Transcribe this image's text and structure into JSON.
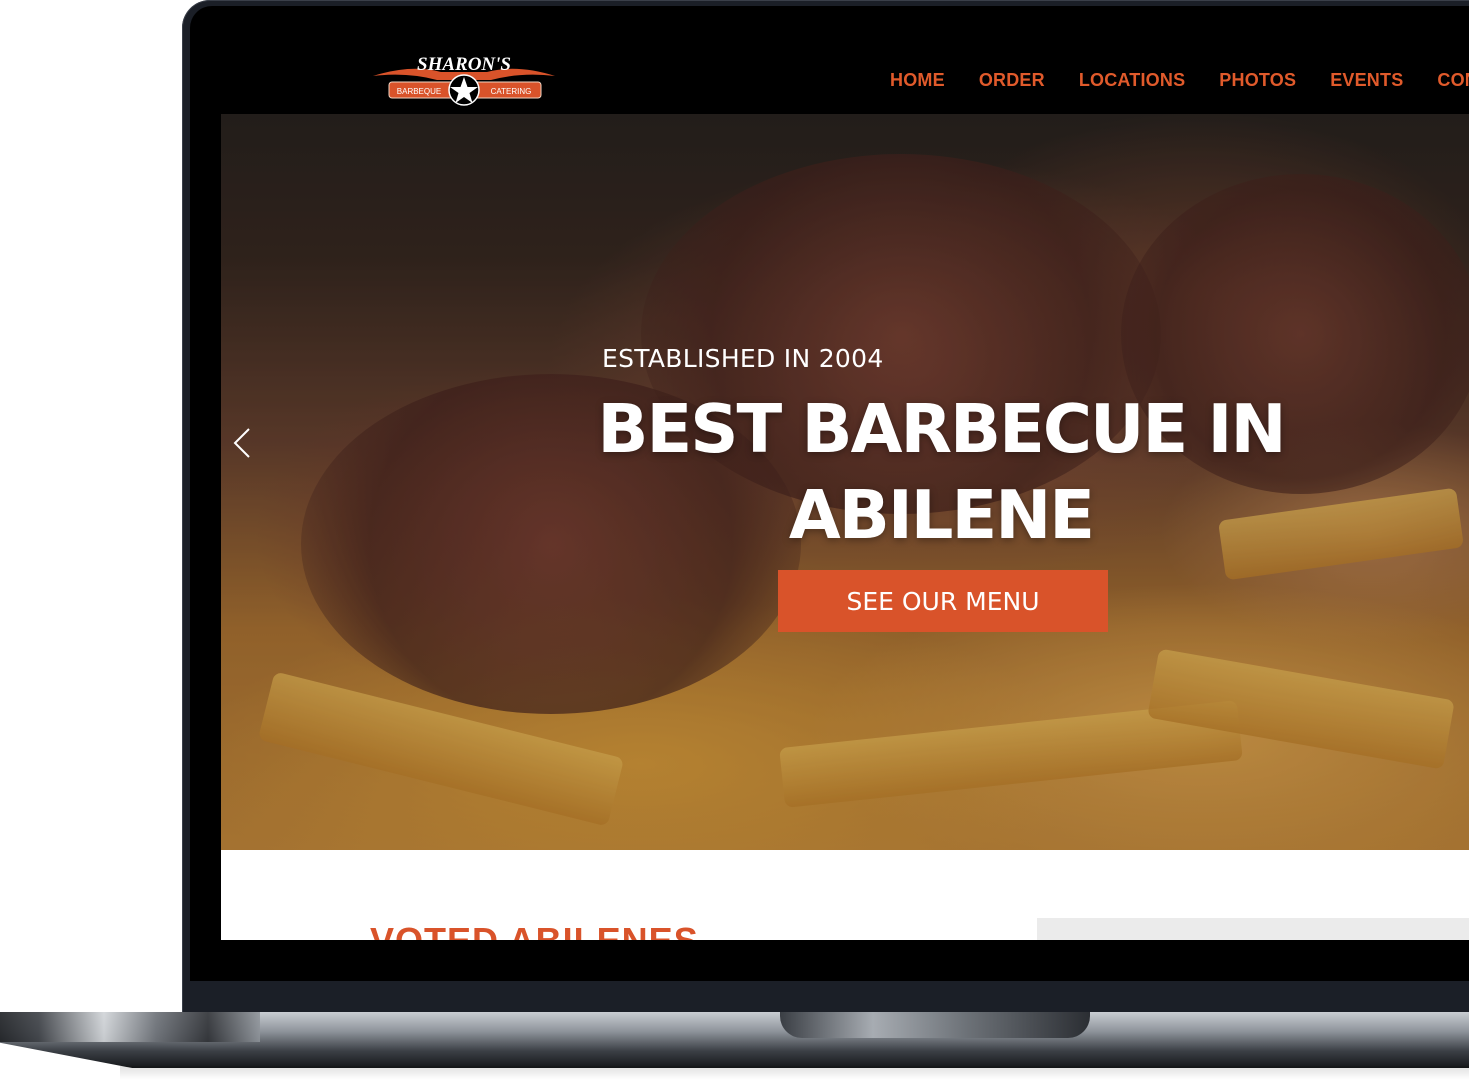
{
  "brand": {
    "logo_top": "SHARON'S",
    "logo_left": "BARBEQUE",
    "logo_right": "CATERING"
  },
  "nav": {
    "items": [
      "HOME",
      "ORDER",
      "LOCATIONS",
      "PHOTOS",
      "EVENTS",
      "CONTA"
    ]
  },
  "hero": {
    "eyebrow": "ESTABLISHED IN 2004",
    "headline_line1": "BEST BARBECUE IN",
    "headline_line2": "ABILENE",
    "cta": "SEE OUR MENU"
  },
  "section": {
    "heading": "VOTED ABILENES"
  },
  "icons": {
    "prev": "chevron-left-icon"
  },
  "colors": {
    "accent": "#d9532a",
    "nav_text": "#e05a2b",
    "header_bg": "#000000"
  }
}
